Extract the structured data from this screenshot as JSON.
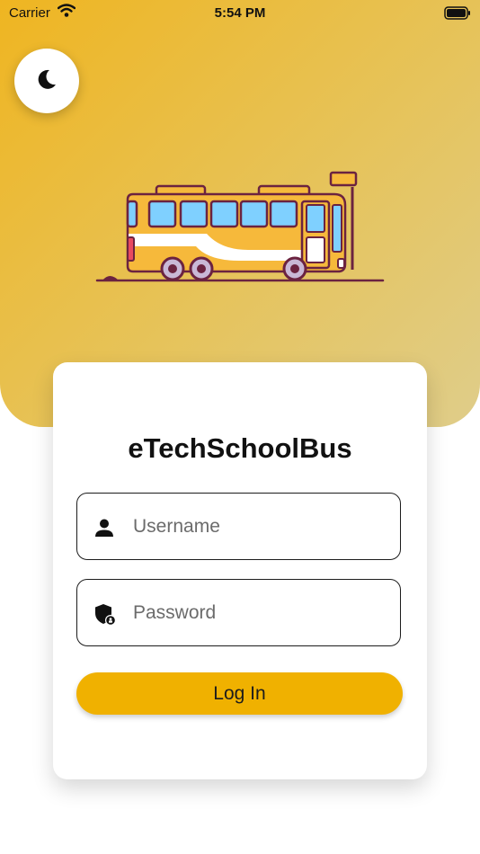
{
  "status_bar": {
    "carrier": "Carrier",
    "time": "5:54 PM"
  },
  "theme_toggle": {
    "icon": "moon-icon"
  },
  "illustration": {
    "icon": "school-bus-illustration"
  },
  "login": {
    "title": "eTechSchoolBus",
    "username_placeholder": "Username",
    "username_icon": "user-icon",
    "password_placeholder": "Password",
    "password_icon": "shield-lock-icon",
    "submit_label": "Log In"
  },
  "colors": {
    "accent": "#f0b100",
    "hero_start": "#efb521",
    "hero_end": "#dfcd8a",
    "text": "#111111"
  }
}
